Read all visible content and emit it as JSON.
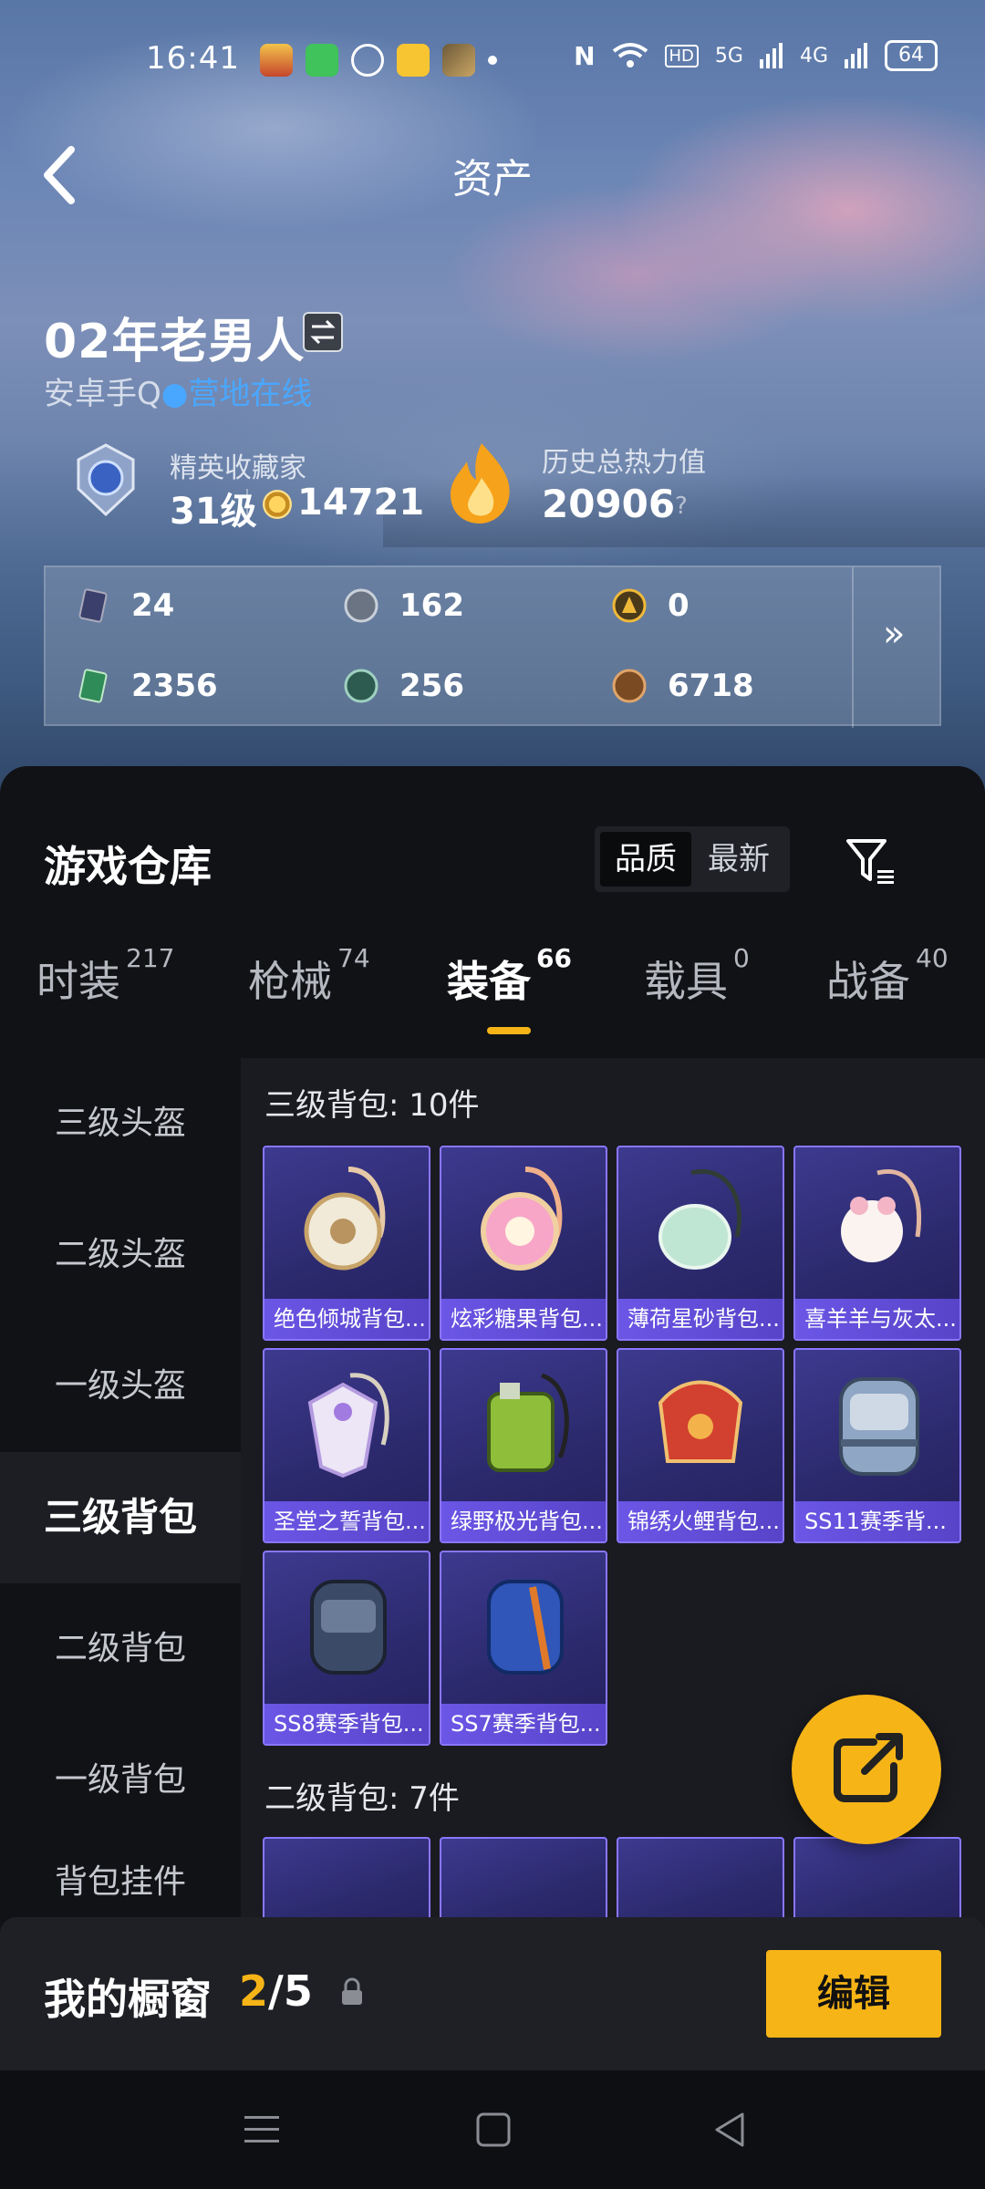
{
  "status_bar": {
    "time": "16:41",
    "network": "5G",
    "network2": "4G",
    "battery": "64"
  },
  "header": {
    "title": "资产"
  },
  "user": {
    "name": "02年老男人",
    "platform": "安卓手Q",
    "status": "营地在线"
  },
  "collector": {
    "title": "精英收藏家",
    "level": "31级",
    "coins": "14721"
  },
  "heat": {
    "title": "历史总热力值",
    "value": "20906",
    "help": "?"
  },
  "resources": [
    {
      "icon": "card-icon",
      "value": "24"
    },
    {
      "icon": "silver-coin-icon",
      "value": "162"
    },
    {
      "icon": "gold-badge-icon",
      "value": "0"
    },
    {
      "icon": "ticket-icon",
      "value": "2356"
    },
    {
      "icon": "green-coin-icon",
      "value": "256"
    },
    {
      "icon": "bronze-coin-icon",
      "value": "6718"
    }
  ],
  "warehouse": {
    "title": "游戏仓库",
    "sort": {
      "options": [
        "品质",
        "最新"
      ],
      "selected": "品质"
    },
    "tabs": [
      {
        "label": "时装",
        "count": "217"
      },
      {
        "label": "枪械",
        "count": "74"
      },
      {
        "label": "装备",
        "count": "66"
      },
      {
        "label": "载具",
        "count": "0"
      },
      {
        "label": "战备",
        "count": "40"
      }
    ],
    "active_tab": "装备",
    "categories": [
      "三级头盔",
      "二级头盔",
      "一级头盔",
      "三级背包",
      "二级背包",
      "一级背包",
      "背包挂件"
    ],
    "active_category": "三级背包",
    "groups": [
      {
        "title": "三级背包: 10件",
        "items": [
          "绝色倾城背包...",
          "炫彩糖果背包...",
          "薄荷星砂背包...",
          "喜羊羊与灰太...",
          "圣堂之誓背包...",
          "绿野极光背包...",
          "锦绣火鲤背包...",
          "SS11赛季背...",
          "SS8赛季背包...",
          "SS7赛季背包..."
        ]
      },
      {
        "title": "二级背包: 7件",
        "items": []
      }
    ]
  },
  "showcase": {
    "label": "我的橱窗",
    "current": "2",
    "total": "5",
    "edit_label": "编辑"
  },
  "colors": {
    "accent": "#f6b417",
    "card_border": "#8a76ff",
    "online": "#4aa7ff"
  }
}
